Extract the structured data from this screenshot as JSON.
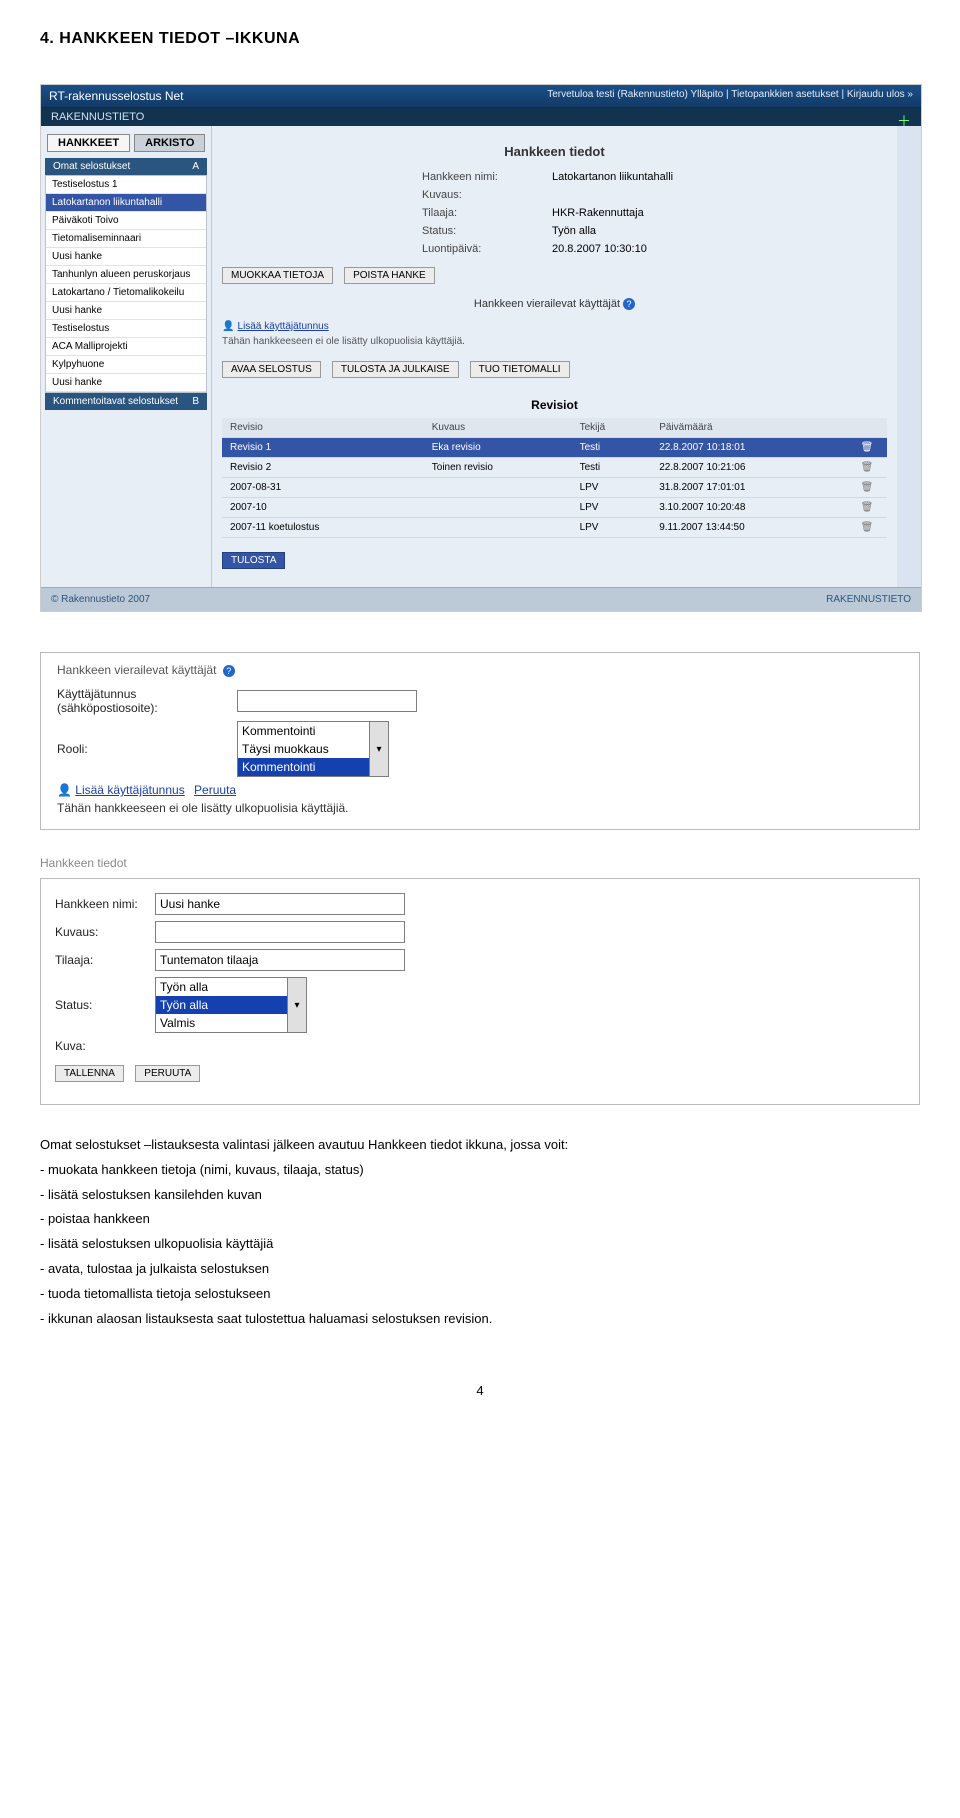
{
  "doc_title": "4. HANKKEEN TIEDOT –IKKUNA",
  "screenshot": {
    "titlebar": "RT-rakennusselostus Net",
    "titlebar_right": "Tervetuloa testi (Rakennustieto)\nYlläpito | Tietopankkien asetukset | Kirjaudu ulos »",
    "subheader": "RAKENNUSTIETO",
    "tabs": {
      "active": "HANKKEET",
      "inactive": "ARKISTO"
    },
    "sidebar": {
      "header": "Omat selostukset",
      "badge": "A",
      "items": [
        "Testiselostus 1",
        "Latokartanon liikuntahalli",
        "Päiväkoti Toivo",
        "Tietomaliseminnaari",
        "Uusi hanke",
        "Tanhunlyn alueen peruskorjaus",
        "Latokartano / Tietomalikokeilu",
        "Uusi hanke",
        "Testiselostus",
        "ACA Malliprojekti",
        "Kylpyhuone",
        "Uusi hanke"
      ],
      "selected_index": 1,
      "footer": "Kommentoitavat selostukset",
      "footer_badge": "B"
    },
    "main": {
      "title": "Hankkeen tiedot",
      "fields": [
        {
          "label": "Hankkeen nimi:",
          "value": "Latokartanon liikuntahalli"
        },
        {
          "label": "Kuvaus:",
          "value": ""
        },
        {
          "label": "Tilaaja:",
          "value": "HKR-Rakennuttaja"
        },
        {
          "label": "Status:",
          "value": "Työn alla"
        },
        {
          "label": "Luontipäivä:",
          "value": "20.8.2007 10:30:10"
        }
      ],
      "btn_edit": "MUOKKAA TIETOJA",
      "btn_delete": "POISTA HANKE",
      "sub_title": "Hankkeen vierailevat käyttäjät",
      "add_user_link": "Lisää käyttäjätunnus",
      "no_users": "Tähän hankkeeseen ei ole lisätty ulkopuolisia käyttäjiä.",
      "btn_open": "AVAA SELOSTUS",
      "btn_publish": "TULOSTA JA JULKAISE",
      "btn_import": "TUO TIETOMALLI",
      "rev_title": "Revisiot",
      "rev_headers": [
        "Revisio",
        "Kuvaus",
        "Tekijä",
        "Päivämäärä"
      ],
      "revisions": [
        {
          "r": "Revisio 1",
          "k": "Eka revisio",
          "t": "Testi",
          "p": "22.8.2007 10:18:01",
          "selected": true
        },
        {
          "r": "Revisio 2",
          "k": "Toinen revisio",
          "t": "Testi",
          "p": "22.8.2007 10:21:06"
        },
        {
          "r": "2007-08-31",
          "k": "",
          "t": "LPV",
          "p": "31.8.2007 17:01:01"
        },
        {
          "r": "2007-10",
          "k": "",
          "t": "LPV",
          "p": "3.10.2007 10:20:48"
        },
        {
          "r": "2007-11 koetulostus",
          "k": "",
          "t": "LPV",
          "p": "9.11.2007 13:44:50"
        }
      ],
      "btn_print": "TULOSTA"
    },
    "footer_left": "© Rakennustieto 2007",
    "footer_right": "RAKENNUSTIETO"
  },
  "block2": {
    "title": "Hankkeen vierailevat käyttäjät",
    "field1_label": "Käyttäjätunnus (sähköpostiosoite):",
    "field2_label": "Rooli:",
    "role_options": [
      "Kommentointi",
      "Täysi muokkaus",
      "Kommentointi"
    ],
    "role_selected_index": 2,
    "link_add": "Lisää käyttäjätunnus",
    "link_cancel": "Peruuta",
    "note": "Tähän hankkeeseen ei ole lisätty ulkopuolisia käyttäjiä."
  },
  "block3": {
    "title": "Hankkeen tiedot",
    "rows": [
      {
        "label": "Hankkeen nimi:",
        "value": "Uusi hanke"
      },
      {
        "label": "Kuvaus:",
        "value": ""
      },
      {
        "label": "Tilaaja:",
        "value": "Tuntematon tilaaja"
      }
    ],
    "status_label": "Status:",
    "status_options": [
      "Työn alla",
      "Työn alla",
      "Valmis"
    ],
    "status_selected_index": 1,
    "kuva_label": "Kuva:",
    "btn_save": "TALLENNA",
    "btn_cancel": "PERUUTA"
  },
  "body_text": {
    "intro": "Omat selostukset –listauksesta valintasi jälkeen avautuu Hankkeen tiedot ikkuna, jossa voit:",
    "items": [
      "- muokata hankkeen tietoja (nimi, kuvaus, tilaaja, status)",
      "- lisätä selostuksen kansilehden kuvan",
      "- poistaa hankkeen",
      "- lisätä selostuksen ulkopuolisia käyttäjiä",
      "- avata, tulostaa ja julkaista selostuksen",
      "- tuoda tietomallista tietoja selostukseen",
      "- ikkunan alaosan listauksesta saat tulostettua haluamasi selostuksen revision."
    ]
  },
  "page_number": "4"
}
